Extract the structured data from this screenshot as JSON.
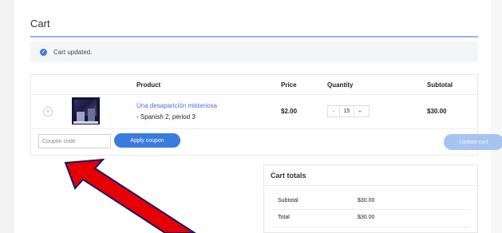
{
  "page": {
    "title": "Cart"
  },
  "notice": {
    "icon": "check-circle-icon",
    "text": "Cart updated."
  },
  "table": {
    "headers": {
      "product": "Product",
      "price": "Price",
      "quantity": "Quantity",
      "subtotal": "Subtotal"
    },
    "items": [
      {
        "remove_symbol": "×",
        "thumbnail_icon": "book-cover-image",
        "name": "Una desaparición misteriosa",
        "variant": "- Spanish 2, period 3",
        "price": "$2.00",
        "quantity": {
          "minus": "-",
          "value": "15",
          "plus": "+"
        },
        "subtotal": "$30.00"
      }
    ]
  },
  "actions": {
    "coupon_placeholder": "Coupon code",
    "apply_label": "Apply coupon",
    "update_label": "Update cart"
  },
  "totals": {
    "title": "Cart totals",
    "subtotal_label": "Subtotal",
    "subtotal_value": "$30.00",
    "total_label": "Total",
    "total_value": "$30.00"
  },
  "colors": {
    "accent": "#3a7be0",
    "link": "#4a70d6",
    "annotation_arrow": "#e60000"
  }
}
